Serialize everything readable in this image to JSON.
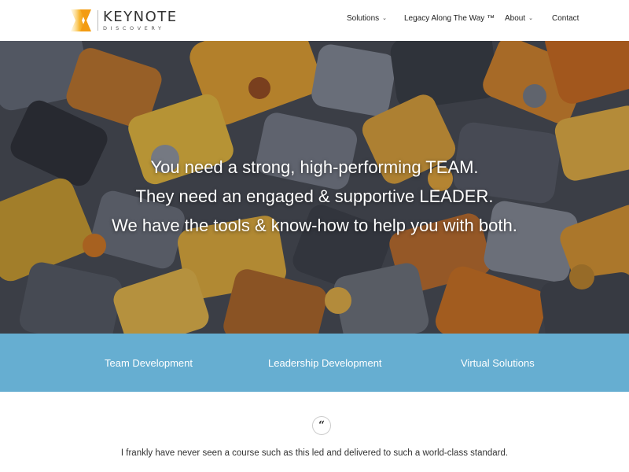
{
  "brand": {
    "name": "KEYNOTE",
    "tagline": "DISCOVERY",
    "colors": {
      "accent_orange": "#f39c12",
      "band_blue": "#66aed1"
    }
  },
  "nav": {
    "items": [
      {
        "label": "Solutions",
        "has_dropdown": true
      },
      {
        "label": "Legacy Along The Way ™",
        "has_dropdown": false
      },
      {
        "label": "About",
        "has_dropdown": true
      },
      {
        "label": "Contact",
        "has_dropdown": false
      }
    ],
    "dropdown_icon": "chevron-down-icon"
  },
  "hero": {
    "lines": [
      "You need a strong, high-performing TEAM.",
      "They need an engaged & supportive LEADER.",
      "We have the tools & know-how to help you with both."
    ]
  },
  "band": {
    "links": [
      "Team Development",
      "Leadership Development",
      "Virtual Solutions"
    ]
  },
  "testimonial": {
    "icon": "quote-icon",
    "glyph": "“",
    "text": "I frankly have never seen a course such as this led and delivered to such a world-class standard."
  }
}
